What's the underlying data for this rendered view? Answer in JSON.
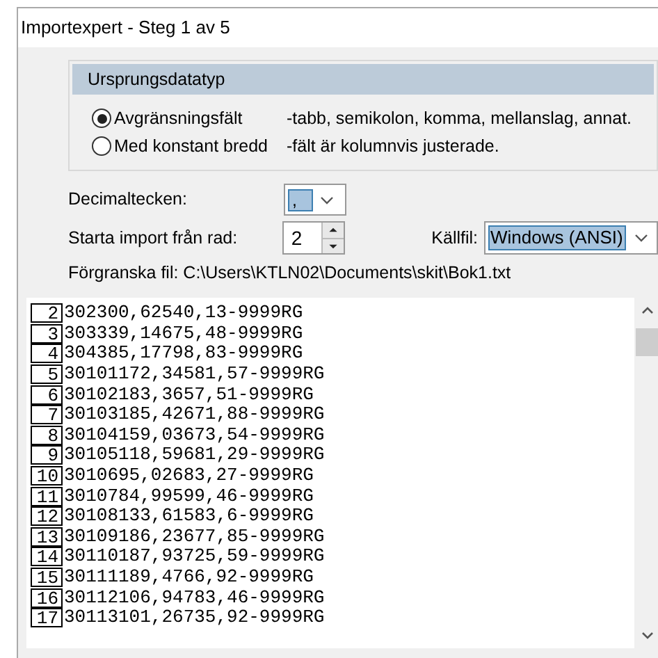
{
  "window": {
    "title": "Importexpert - Steg 1 av 5"
  },
  "source_type": {
    "title": "Ursprungsdatatyp",
    "options": [
      {
        "label": "Avgränsningsfält",
        "description": "-tabb, semikolon, komma, mellanslag, annat.",
        "selected": true
      },
      {
        "label": "Med konstant bredd",
        "description": "-fält är kolumnvis justerade.",
        "selected": false
      }
    ]
  },
  "decimal": {
    "label": "Decimaltecken:",
    "value": ","
  },
  "start_row": {
    "label": "Starta import från rad:",
    "value": "2"
  },
  "source_file": {
    "label": "Källfil:",
    "value": "Windows (ANSI)"
  },
  "preview_label": "Förgranska fil: C:\\Users\\KTLN02\\Documents\\skit\\Bok1.txt",
  "preview_rows": [
    {
      "number": "2",
      "text": "302300,62540,13-9999RG"
    },
    {
      "number": "3",
      "text": "303339,14675,48-9999RG"
    },
    {
      "number": "4",
      "text": "304385,17798,83-9999RG"
    },
    {
      "number": "5",
      "text": "30101172,34581,57-9999RG"
    },
    {
      "number": "6",
      "text": "30102183,3657,51-9999RG"
    },
    {
      "number": "7",
      "text": "30103185,42671,88-9999RG"
    },
    {
      "number": "8",
      "text": "30104159,03673,54-9999RG"
    },
    {
      "number": "9",
      "text": "30105118,59681,29-9999RG"
    },
    {
      "number": "10",
      "text": "3010695,02683,27-9999RG"
    },
    {
      "number": "11",
      "text": "3010784,99599,46-9999RG"
    },
    {
      "number": "12",
      "text": "30108133,61583,6-9999RG"
    },
    {
      "number": "13",
      "text": "30109186,23677,85-9999RG"
    },
    {
      "number": "14",
      "text": "30110187,93725,59-9999RG"
    },
    {
      "number": "15",
      "text": "30111189,4766,92-9999RG"
    },
    {
      "number": "16",
      "text": "30112106,94783,46-9999RG"
    },
    {
      "number": "17",
      "text": "30113101,26735,92-9999RG"
    }
  ]
}
